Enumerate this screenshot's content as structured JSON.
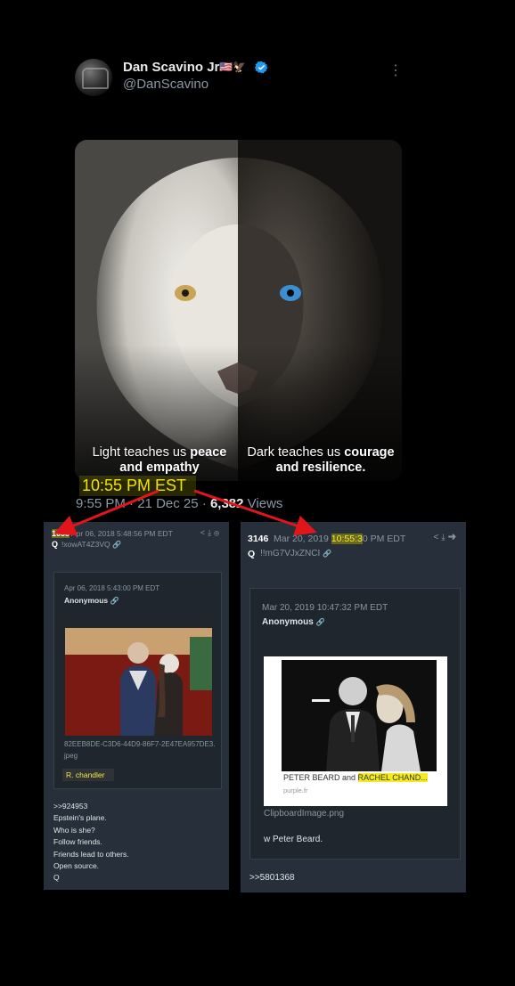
{
  "tweet": {
    "display_name": "Dan Scavino Jr.",
    "flags": "🇺🇸🦅",
    "handle": "@DanScavino",
    "more_icon": "more-vertical-icon",
    "image_caption_left_light": "Light teaches us ",
    "image_caption_left_bold1": "peace",
    "image_caption_left_bold2": "and empathy",
    "image_caption_right_light": "Dark teaches us ",
    "image_caption_right_bold1": "courage",
    "image_caption_right_bold2": "and resilience.",
    "est_annotation": "10:55 PM EST",
    "time": "9:55 PM",
    "separator": " · ",
    "date": "21 Dec 25",
    "views_count": "6,382",
    "views_label": " Views"
  },
  "post_left": {
    "number": "1055",
    "date": "Apr 06, 2018 5:48:56 PM EDT",
    "q_label": "Q",
    "tripcode": "!xowAT4Z3VQ",
    "quoted": {
      "date": "Apr 06, 2018 5:43:00 PM EDT",
      "author": "Anonymous",
      "filename": "82EEB8DE-C3D6-44D9-86F7-2E47EA957DE3.jpeg",
      "tag": "R. chandler"
    },
    "body_lines": [
      ">>924953",
      "Epstein's plane.",
      "Who is she?",
      "Follow friends.",
      "Friends lead to others.",
      "Open source.",
      "Q"
    ]
  },
  "post_right": {
    "number": "3146",
    "date_prefix": "Mar 20, 2019 ",
    "date_highlight": "10:55:3",
    "date_suffix": "0 PM EDT",
    "q_label": "Q",
    "tripcode": "!!mG7VJxZNCI",
    "quoted": {
      "date": "Mar 20, 2019 10:47:32 PM EDT",
      "author": "Anonymous",
      "caption_prefix": "PETER BEARD and ",
      "caption_highlight": "RACHEL CHAND...",
      "site": "purple.fr",
      "filename": "ClipboardImage.png",
      "body": "w Peter Beard."
    },
    "reference": ">>5801368"
  },
  "colors": {
    "background": "#000000",
    "post_bg": "#27303a",
    "highlight_yellow": "#f3e300",
    "arrow_red": "#e0161b",
    "link_blue": "#3b8fe3"
  }
}
